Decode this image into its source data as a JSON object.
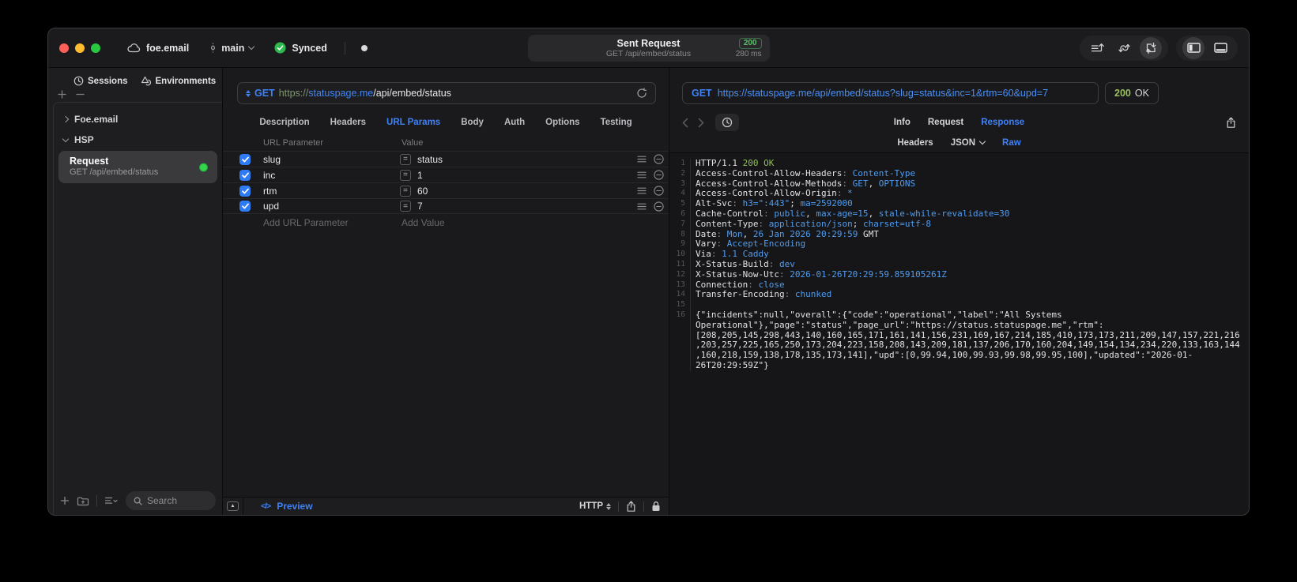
{
  "titlebar": {
    "project": "foe.email",
    "branch": "main",
    "sync_status": "Synced",
    "request_title": "Sent Request",
    "request_subtitle": "GET /api/embed/status",
    "status_badge": "200",
    "duration": "280 ms"
  },
  "sidebar": {
    "tabs": [
      {
        "label": "Sessions"
      },
      {
        "label": "Environments"
      }
    ],
    "tree": [
      {
        "label": "Foe.email",
        "expanded": false
      },
      {
        "label": "HSP",
        "expanded": true
      }
    ],
    "request_item": {
      "name": "Request",
      "subtitle": "GET /api/embed/status"
    },
    "search_placeholder": "Search"
  },
  "request_panel": {
    "method": "GET",
    "url": {
      "scheme": "https://",
      "host": "statuspage.me",
      "path": "/api/embed/status"
    },
    "tabs": [
      {
        "label": "Description"
      },
      {
        "label": "Headers"
      },
      {
        "label": "URL Params",
        "active": true
      },
      {
        "label": "Body"
      },
      {
        "label": "Auth"
      },
      {
        "label": "Options"
      },
      {
        "label": "Testing"
      }
    ],
    "params_table": {
      "columns": [
        "URL Parameter",
        "Value"
      ],
      "rows": [
        {
          "enabled": true,
          "name": "slug",
          "value": "status"
        },
        {
          "enabled": true,
          "name": "inc",
          "value": "1"
        },
        {
          "enabled": true,
          "name": "rtm",
          "value": "60"
        },
        {
          "enabled": true,
          "name": "upd",
          "value": "7"
        }
      ],
      "add_param_placeholder": "Add URL Parameter",
      "add_value_placeholder": "Add Value"
    },
    "footer": {
      "preview_label": "Preview",
      "code_glyph": "</>",
      "protocol": "HTTP"
    }
  },
  "response_panel": {
    "method": "GET",
    "url": "https://statuspage.me/api/embed/status?slug=status&inc=1&rtm=60&upd=7",
    "status_code": "200",
    "status_text": "OK",
    "tabs": [
      {
        "label": "Info"
      },
      {
        "label": "Request"
      },
      {
        "label": "Response",
        "active": true
      }
    ],
    "format_tabs": [
      {
        "label": "Headers"
      },
      {
        "label": "JSON",
        "dropdown": true
      },
      {
        "label": "Raw",
        "active": true
      }
    ],
    "body_lines": [
      {
        "n": "1",
        "segs": [
          {
            "t": "HTTP/1.1 ",
            "c": "plain"
          },
          {
            "t": "200 OK",
            "c": "green"
          }
        ]
      },
      {
        "n": "2",
        "segs": [
          {
            "t": "Access-Control-Allow-Headers",
            "c": "plain"
          },
          {
            "t": ":",
            "c": "dim"
          },
          {
            "t": " Content-Type",
            "c": "blue"
          }
        ]
      },
      {
        "n": "3",
        "segs": [
          {
            "t": "Access-Control-Allow-Methods",
            "c": "plain"
          },
          {
            "t": ":",
            "c": "dim"
          },
          {
            "t": " GET",
            "c": "blue"
          },
          {
            "t": ",",
            "c": "plain"
          },
          {
            "t": " OPTIONS",
            "c": "blue"
          }
        ]
      },
      {
        "n": "4",
        "segs": [
          {
            "t": "Access-Control-Allow-Origin",
            "c": "plain"
          },
          {
            "t": ":",
            "c": "dim"
          },
          {
            "t": " *",
            "c": "blue"
          }
        ]
      },
      {
        "n": "5",
        "segs": [
          {
            "t": "Alt-Svc",
            "c": "plain"
          },
          {
            "t": ":",
            "c": "dim"
          },
          {
            "t": " h3=\":443\"",
            "c": "blue"
          },
          {
            "t": ";",
            "c": "plain"
          },
          {
            "t": " ma=2592000",
            "c": "blue"
          }
        ]
      },
      {
        "n": "6",
        "segs": [
          {
            "t": "Cache-Control",
            "c": "plain"
          },
          {
            "t": ":",
            "c": "dim"
          },
          {
            "t": " public",
            "c": "blue"
          },
          {
            "t": ",",
            "c": "plain"
          },
          {
            "t": " max-age=15",
            "c": "blue"
          },
          {
            "t": ",",
            "c": "plain"
          },
          {
            "t": " stale-while-revalidate=30",
            "c": "blue"
          }
        ]
      },
      {
        "n": "7",
        "segs": [
          {
            "t": "Content-Type",
            "c": "plain"
          },
          {
            "t": ":",
            "c": "dim"
          },
          {
            "t": " application/json",
            "c": "blue"
          },
          {
            "t": ";",
            "c": "plain"
          },
          {
            "t": " charset=utf-8",
            "c": "blue"
          }
        ]
      },
      {
        "n": "8",
        "segs": [
          {
            "t": "Date",
            "c": "plain"
          },
          {
            "t": ":",
            "c": "dim"
          },
          {
            "t": " Mon",
            "c": "blue"
          },
          {
            "t": ",",
            "c": "plain"
          },
          {
            "t": " 26 Jan 2026 20:29:59",
            "c": "blue"
          },
          {
            "t": " GMT",
            "c": "plain"
          }
        ]
      },
      {
        "n": "9",
        "segs": [
          {
            "t": "Vary",
            "c": "plain"
          },
          {
            "t": ":",
            "c": "dim"
          },
          {
            "t": " Accept-Encoding",
            "c": "blue"
          }
        ]
      },
      {
        "n": "10",
        "segs": [
          {
            "t": "Via",
            "c": "plain"
          },
          {
            "t": ":",
            "c": "dim"
          },
          {
            "t": " 1.1 Caddy",
            "c": "blue"
          }
        ]
      },
      {
        "n": "11",
        "segs": [
          {
            "t": "X-Status-Build",
            "c": "plain"
          },
          {
            "t": ":",
            "c": "dim"
          },
          {
            "t": " dev",
            "c": "blue"
          }
        ]
      },
      {
        "n": "12",
        "segs": [
          {
            "t": "X-Status-Now-Utc",
            "c": "plain"
          },
          {
            "t": ":",
            "c": "dim"
          },
          {
            "t": " 2026-01-26T20:29:59.859105261Z",
            "c": "blue"
          }
        ]
      },
      {
        "n": "13",
        "segs": [
          {
            "t": "Connection",
            "c": "plain"
          },
          {
            "t": ":",
            "c": "dim"
          },
          {
            "t": " close",
            "c": "blue"
          }
        ]
      },
      {
        "n": "14",
        "segs": [
          {
            "t": "Transfer-Encoding",
            "c": "plain"
          },
          {
            "t": ":",
            "c": "dim"
          },
          {
            "t": " chunked",
            "c": "blue"
          }
        ]
      },
      {
        "n": "15",
        "segs": []
      },
      {
        "n": "16",
        "segs": [
          {
            "t": "{\"incidents\":null,\"overall\":{\"code\":\"operational\",\"label\":\"All Systems Operational\"},\"page\":\"status\",\"page_url\":\"https://status.statuspage.me\",\"rtm\":[208,205,145,298,443,140,160,165,171,161,141,156,231,169,167,214,185,410,173,173,211,209,147,157,221,216,203,257,225,165,250,173,204,223,158,208,143,209,181,137,206,170,160,204,149,154,134,234,220,133,163,144,160,218,159,138,178,135,173,141],\"upd\":[0,99.94,100,99.93,99.98,99.95,100],\"updated\":\"2026-01-26T20:29:59Z\"}",
            "c": "plain"
          }
        ]
      }
    ]
  },
  "colors": {
    "accent_blue": "#3e82f7",
    "status_green": "#32d74b",
    "code_value_blue": "#4f9cf0",
    "code_status_green": "#8fbe52",
    "checkbox_blue": "#2e7bf6"
  }
}
